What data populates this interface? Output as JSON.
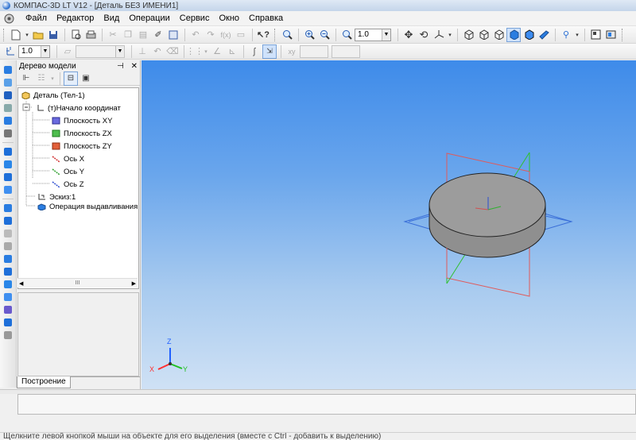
{
  "window": {
    "title": "КОМПАС-3D LT V12 - [Деталь БЕЗ ИМЕНИ1]"
  },
  "menu": [
    "Файл",
    "Редактор",
    "Вид",
    "Операции",
    "Сервис",
    "Окно",
    "Справка"
  ],
  "toolbar": {
    "zoom_value": "1.0"
  },
  "toolbar2": {
    "step_value": "1.0",
    "disabled_combo_1": "",
    "disabled_combo_2": ""
  },
  "panel": {
    "title": "Дерево модели",
    "tree": [
      {
        "label": "Деталь (Тел-1)",
        "icon": "part-icon"
      },
      {
        "label": "(т)Начало координат",
        "icon": "origin-icon"
      },
      {
        "label": "Плоскость XY",
        "icon": "plane-xy-icon"
      },
      {
        "label": "Плоскость ZX",
        "icon": "plane-zx-icon"
      },
      {
        "label": "Плоскость ZY",
        "icon": "plane-zy-icon"
      },
      {
        "label": "Ось X",
        "icon": "axis-x-icon"
      },
      {
        "label": "Ось Y",
        "icon": "axis-y-icon"
      },
      {
        "label": "Ось Z",
        "icon": "axis-z-icon"
      },
      {
        "label": "Эскиз:1",
        "icon": "sketch-icon"
      },
      {
        "label": "Операция выдавливания",
        "icon": "extrusion-icon"
      }
    ],
    "tab_label": "Построение",
    "scroll_mid": "III"
  },
  "viewport": {
    "triad": {
      "z": "Z",
      "x": "X",
      "y": "Y"
    },
    "colors": {
      "x": "#ff3030",
      "y": "#20c020",
      "z": "#2060ff"
    }
  },
  "status": {
    "hint": "Щелкните левой кнопкой мыши на объекте для его выделения (вместе с Ctrl - добавить к выделению)"
  }
}
